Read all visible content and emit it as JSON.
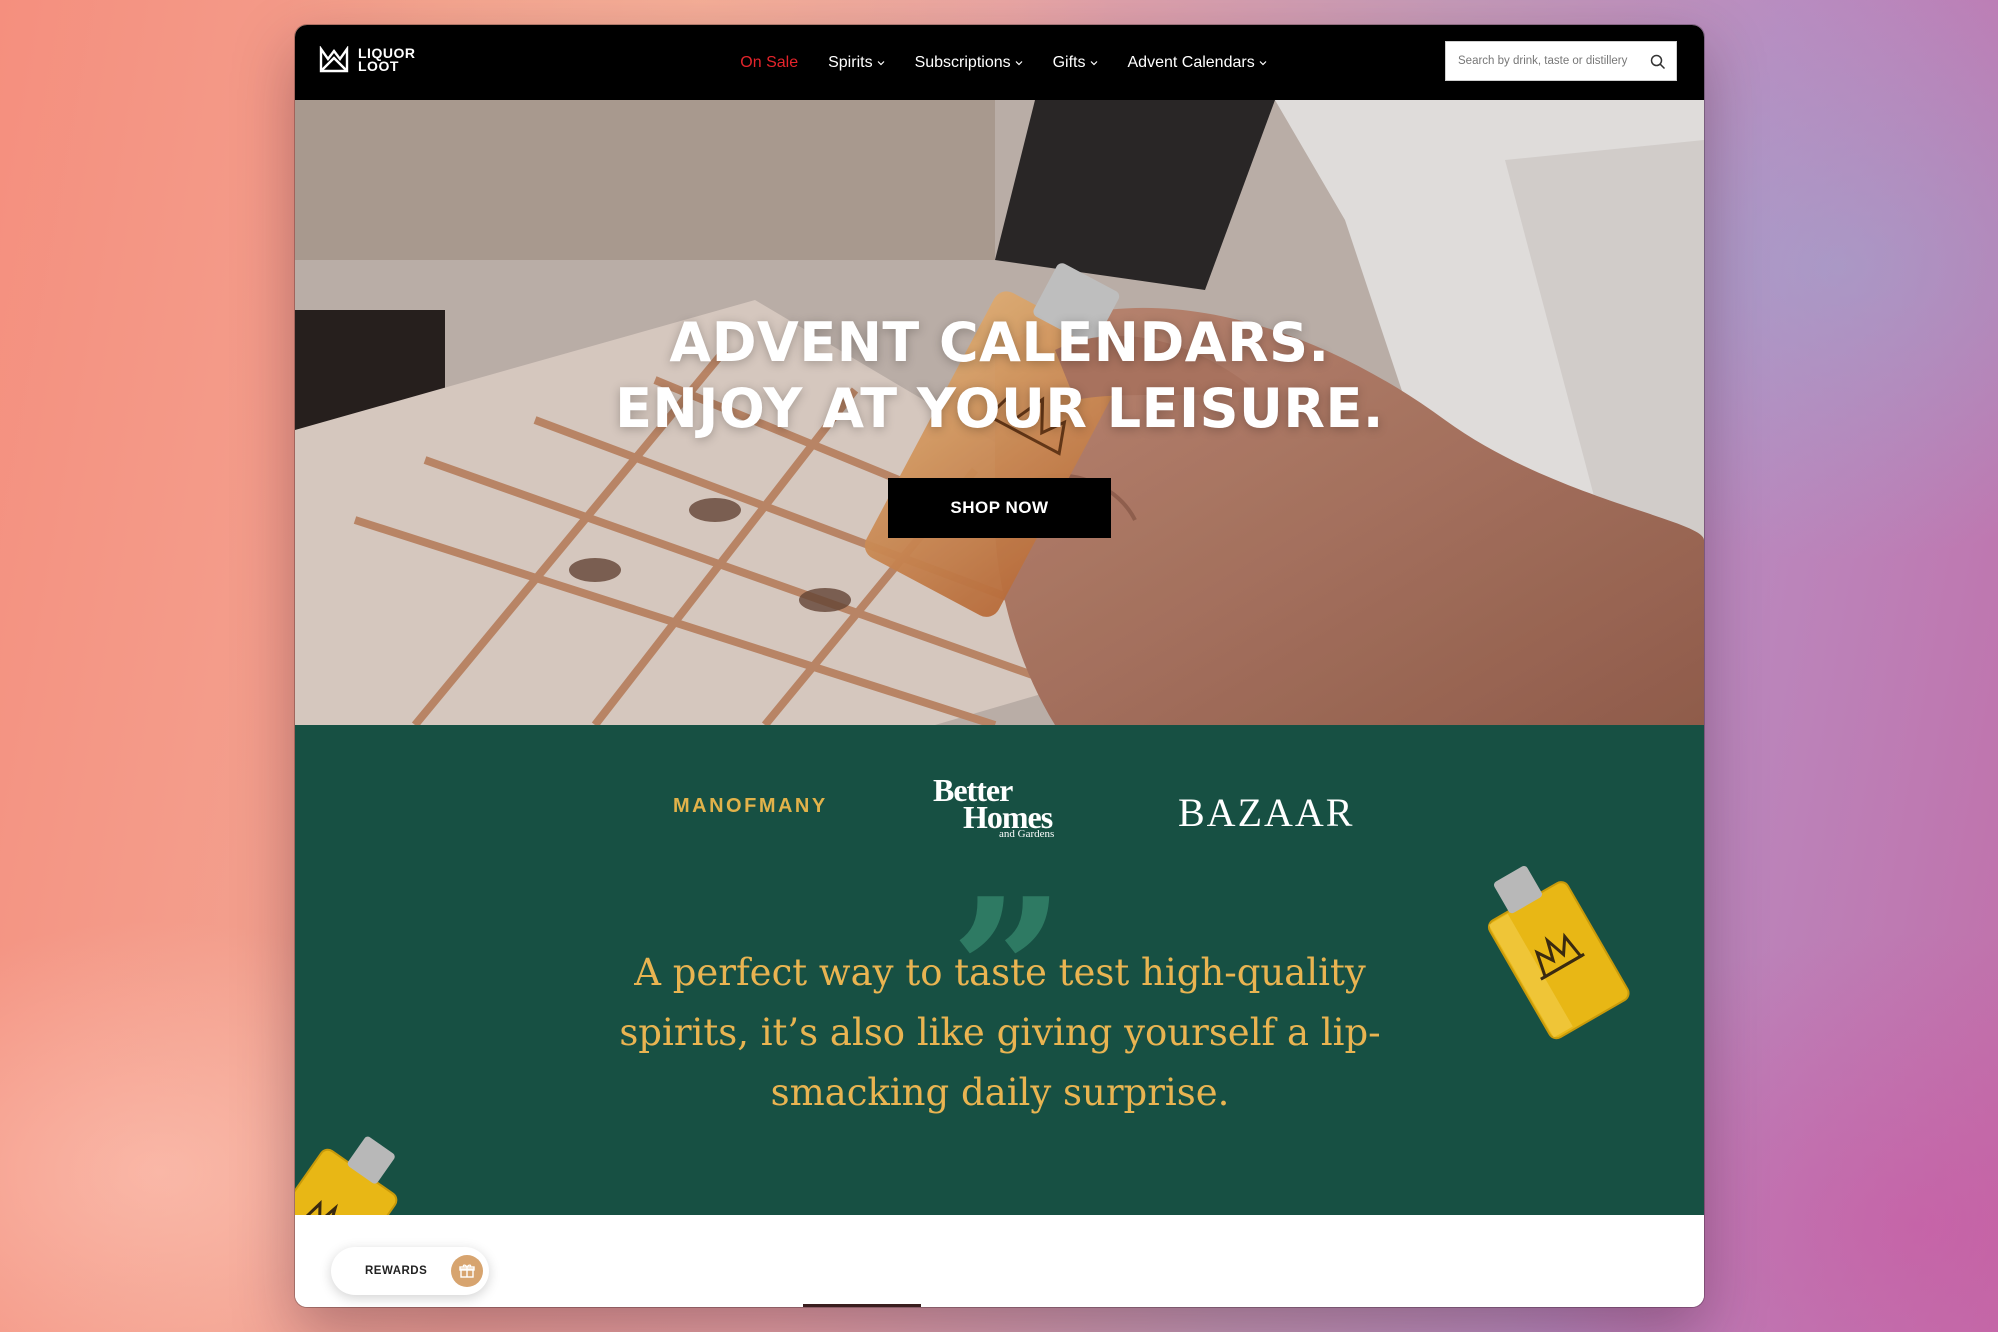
{
  "brand": {
    "logo_text": "LIQUOR\nLOOT"
  },
  "nav": {
    "items": [
      {
        "label": "On Sale",
        "dropdown": false,
        "color": "#e5242b"
      },
      {
        "label": "Spirits",
        "dropdown": true
      },
      {
        "label": "Subscriptions",
        "dropdown": true
      },
      {
        "label": "Gifts",
        "dropdown": true
      },
      {
        "label": "Advent Calendars",
        "dropdown": true
      }
    ]
  },
  "search": {
    "placeholder": "Search by drink, taste or distillery",
    "icon": "search-icon"
  },
  "hero": {
    "title_line1": "ADVENT CALENDARS.",
    "title_line2": "ENJOY AT YOUR LEISURE.",
    "cta_label": "SHOP NOW"
  },
  "press": {
    "logos": {
      "manofmany": "MANOFMANY",
      "bhg_line1": "Better",
      "bhg_line2": "Homes",
      "bhg_line3": "and Gardens",
      "bazaar": "BAZAAR"
    },
    "quote": "A perfect way to taste test high-quality spirits, it’s also like giving yourself a lip-smacking daily surprise.",
    "background_color": "#175043",
    "quote_color": "#e9b451"
  },
  "rewards": {
    "label": "REWARDS",
    "icon": "gift-icon"
  }
}
